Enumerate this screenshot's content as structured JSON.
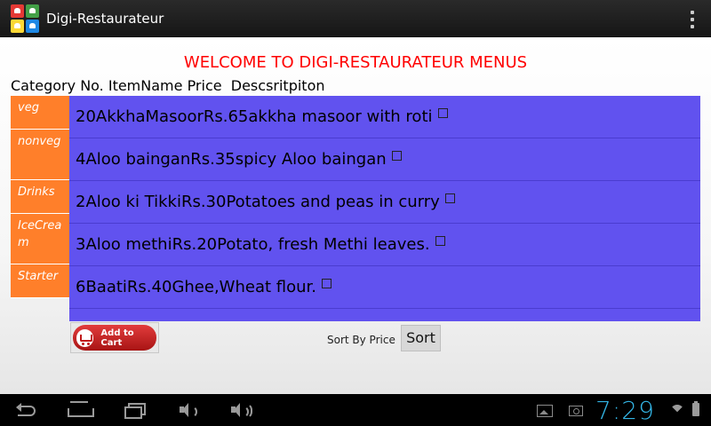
{
  "app": {
    "title": "Digi-Restaurateur"
  },
  "welcome": "WELCOME TO DIGI-RESTAURATEUR MENUS",
  "headers": {
    "category": "Category",
    "no": "No.",
    "item_name": "ItemName",
    "price": "Price",
    "description": "Descsritpiton"
  },
  "categories": [
    "veg",
    "nonveg",
    "Drinks",
    "IceCream",
    "Starter"
  ],
  "menu": [
    {
      "no": "20",
      "name": "AkkhaMasoor",
      "price": "Rs.65",
      "description": "akkha masoor with roti"
    },
    {
      "no": "4",
      "name": "Aloo baingan",
      "price": "Rs.35",
      "description": "spicy Aloo baingan"
    },
    {
      "no": "2",
      "name": "Aloo ki Tikki",
      "price": "Rs.30",
      "description": "Potatoes and peas in curry"
    },
    {
      "no": "3",
      "name": "Aloo methi",
      "price": "Rs.20",
      "description": "Potato, fresh Methi leaves."
    },
    {
      "no": "6",
      "name": "Baati",
      "price": "Rs.40",
      "description": "Ghee,Wheat flour."
    }
  ],
  "actions": {
    "add_to_cart": "Add to Cart",
    "sort_by_label": "Sort By Price",
    "sort_button": "Sort"
  },
  "status": {
    "time": "7:29"
  },
  "colors": {
    "menu_bg": "#6152ef",
    "category_bg": "#ff7f2a",
    "welcome_text": "#ff0000",
    "clock": "#33b5e5"
  }
}
